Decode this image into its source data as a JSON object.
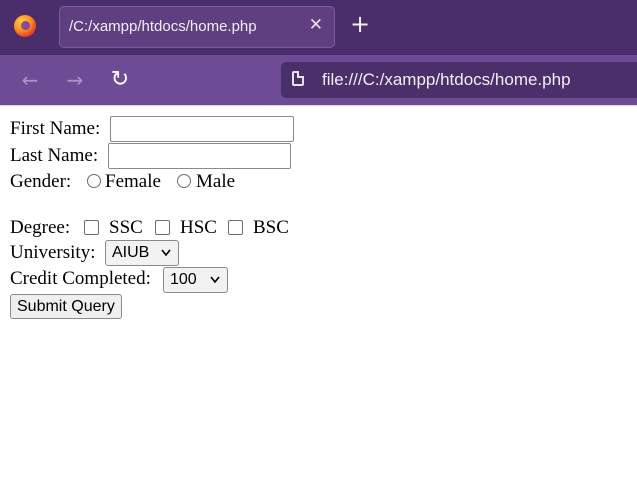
{
  "browser": {
    "tab_title": "/C:/xampp/htdocs/home.php",
    "tab_close": "✕",
    "new_tab": "+",
    "back": "←",
    "forward": "→",
    "reload": "↻",
    "url": "file:///C:/xampp/htdocs/home.php"
  },
  "form": {
    "first_name_label": "First Name:",
    "first_name_value": "",
    "last_name_label": "Last Name:",
    "last_name_value": "",
    "gender_label": "Gender:",
    "gender_options": [
      "Female",
      "Male"
    ],
    "degree_label": "Degree:",
    "degree_options": [
      "SSC",
      "HSC",
      "BSC"
    ],
    "university_label": "University:",
    "university_selected": "AIUB",
    "credit_label": "Credit Completed:",
    "credit_selected": "100",
    "submit_label": "Submit Query"
  },
  "icons": {
    "browser_logo": "firefox-icon",
    "page": "page-icon",
    "dropdown": "chevron-down-icon"
  },
  "colors": {
    "tabbar": "#4a2d6b",
    "toolbar": "#6e4c95",
    "urlbar": "#4b2f6a"
  }
}
